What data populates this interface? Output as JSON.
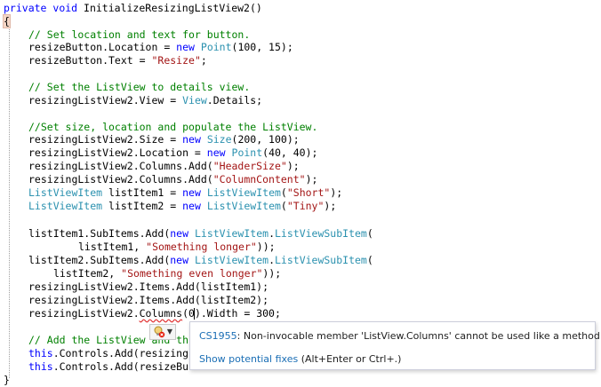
{
  "code": {
    "signature": {
      "kw1": "private",
      "kw2": "void",
      "method": " InitializeResizingListView2()"
    },
    "open_brace": "{",
    "close_brace": "}",
    "lines": {
      "l3": "// Set location and text for button.",
      "l4": {
        "a": "resizeButton.Location = ",
        "kw": "new",
        "t": "Point",
        "b": "(100, 15);"
      },
      "l5": {
        "a": "resizeButton.Text = ",
        "s": "\"Resize\"",
        "b": ";"
      },
      "l7": "// Set the ListView to details view.",
      "l8": {
        "a": "resizingListView2.View = ",
        "t": "View",
        "b": ".Details;"
      },
      "l10": "//Set size, location and populate the ListView.",
      "l11": {
        "a": "resizingListView2.Size = ",
        "kw": "new",
        "t": "Size",
        "b": "(200, 100);"
      },
      "l12": {
        "a": "resizingListView2.Location = ",
        "kw": "new",
        "t": "Point",
        "b": "(40, 40);"
      },
      "l13": {
        "a": "resizingListView2.Columns.Add(",
        "s": "\"HeaderSize\"",
        "b": ");"
      },
      "l14": {
        "a": "resizingListView2.Columns.Add(",
        "s": "\"ColumnContent\"",
        "b": ");"
      },
      "l15": {
        "t": "ListViewItem",
        "a": " listItem1 = ",
        "kw": "new",
        "t2": "ListViewItem",
        "s": "\"Short\"",
        "b": ");"
      },
      "l16": {
        "t": "ListViewItem",
        "a": " listItem2 = ",
        "kw": "new",
        "t2": "ListViewItem",
        "s": "\"Tiny\"",
        "b": ");"
      },
      "l18": {
        "a": "listItem1.SubItems.Add(",
        "kw": "new",
        "t": "ListViewItem",
        "dot": ".",
        "t2": "ListViewSubItem",
        "b": "("
      },
      "l19": {
        "a": "listItem1, ",
        "s": "\"Something longer\"",
        "b": "));"
      },
      "l20": {
        "a": "listItem2.SubItems.Add(",
        "kw": "new",
        "t": "ListViewItem",
        "dot": ".",
        "t2": "ListViewSubItem",
        "b": "("
      },
      "l21": {
        "a": "listItem2, ",
        "s": "\"Something even longer\"",
        "b": "));"
      },
      "l22": "resizingListView2.Items.Add(listItem1);",
      "l23": "resizingListView2.Items.Add(listItem2);",
      "l24": {
        "a": "resizingListView2.",
        "sq": "Columns",
        "p1": "(0",
        "p2": ").Width = 300;"
      },
      "l26": {
        "c": "// Add the ListView and th"
      },
      "l27": {
        "kw": "this",
        "a": ".Controls.Add(resizing"
      },
      "l28": {
        "kw": "this",
        "a": ".Controls.Add(resizeBu"
      }
    },
    "paren_open": "("
  },
  "tooltip": {
    "code": "CS1955",
    "message": ": Non-invocable member 'ListView.Columns' cannot be used like a method.",
    "link": "Show potential fixes",
    "shortcut": " (Alt+Enter or Ctrl+.)"
  },
  "colors": {
    "keyword": "#0000ff",
    "type": "#2b91af",
    "string": "#a31515",
    "comment": "#008000",
    "link": "#1a6eb5",
    "error_squiggle": "#e03030"
  }
}
